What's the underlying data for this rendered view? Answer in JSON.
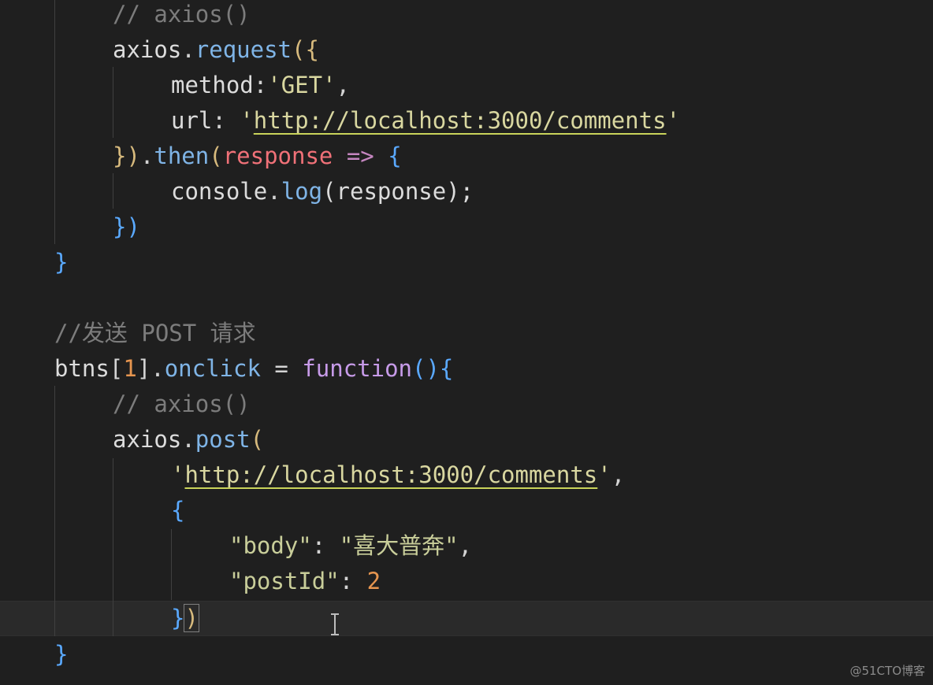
{
  "lines": [
    {
      "comment": "// axios()"
    },
    {
      "obj": "axios",
      "dot": ".",
      "method": "request",
      "open": "({"
    },
    {
      "key": "method",
      "colon": ":",
      "value": "'GET'",
      "comma": ","
    },
    {
      "key": "url",
      "colon": ": ",
      "quote_open": "'",
      "value": "http://localhost:3000/comments",
      "quote_close": "'"
    },
    {
      "close": "})",
      "dot": ".",
      "method": "then",
      "open_paren": "(",
      "param": "response",
      "arrow": " => ",
      "brace": "{"
    },
    {
      "obj": "console",
      "dot": ".",
      "method": "log",
      "args": "(response);"
    },
    {
      "close": "})"
    },
    {
      "close": "}"
    },
    {
      "comment": "//发送 POST 请求"
    },
    {
      "obj": "btns",
      "index_open": "[",
      "index": "1",
      "index_close": "]",
      "dot": ".",
      "prop": "onclick",
      "assign": " = ",
      "keyword": "function",
      "sig": "(){"
    },
    {
      "comment": "// axios()"
    },
    {
      "obj": "axios",
      "dot": ".",
      "method": "post",
      "open": "("
    },
    {
      "quote_open": "'",
      "value": "http://localhost:3000/comments",
      "quote_close": "'",
      "comma": ","
    },
    {
      "brace": "{"
    },
    {
      "key": "\"body\"",
      "colon": ": ",
      "value": "\"喜大普奔\"",
      "comma": ","
    },
    {
      "key": "\"postId\"",
      "colon": ": ",
      "value": "2"
    },
    {
      "close_brace": "}",
      "close_paren": ")"
    },
    {
      "close": "}"
    }
  ],
  "watermark": "@51CTO博客",
  "cursor_icon": "text-cursor-icon"
}
